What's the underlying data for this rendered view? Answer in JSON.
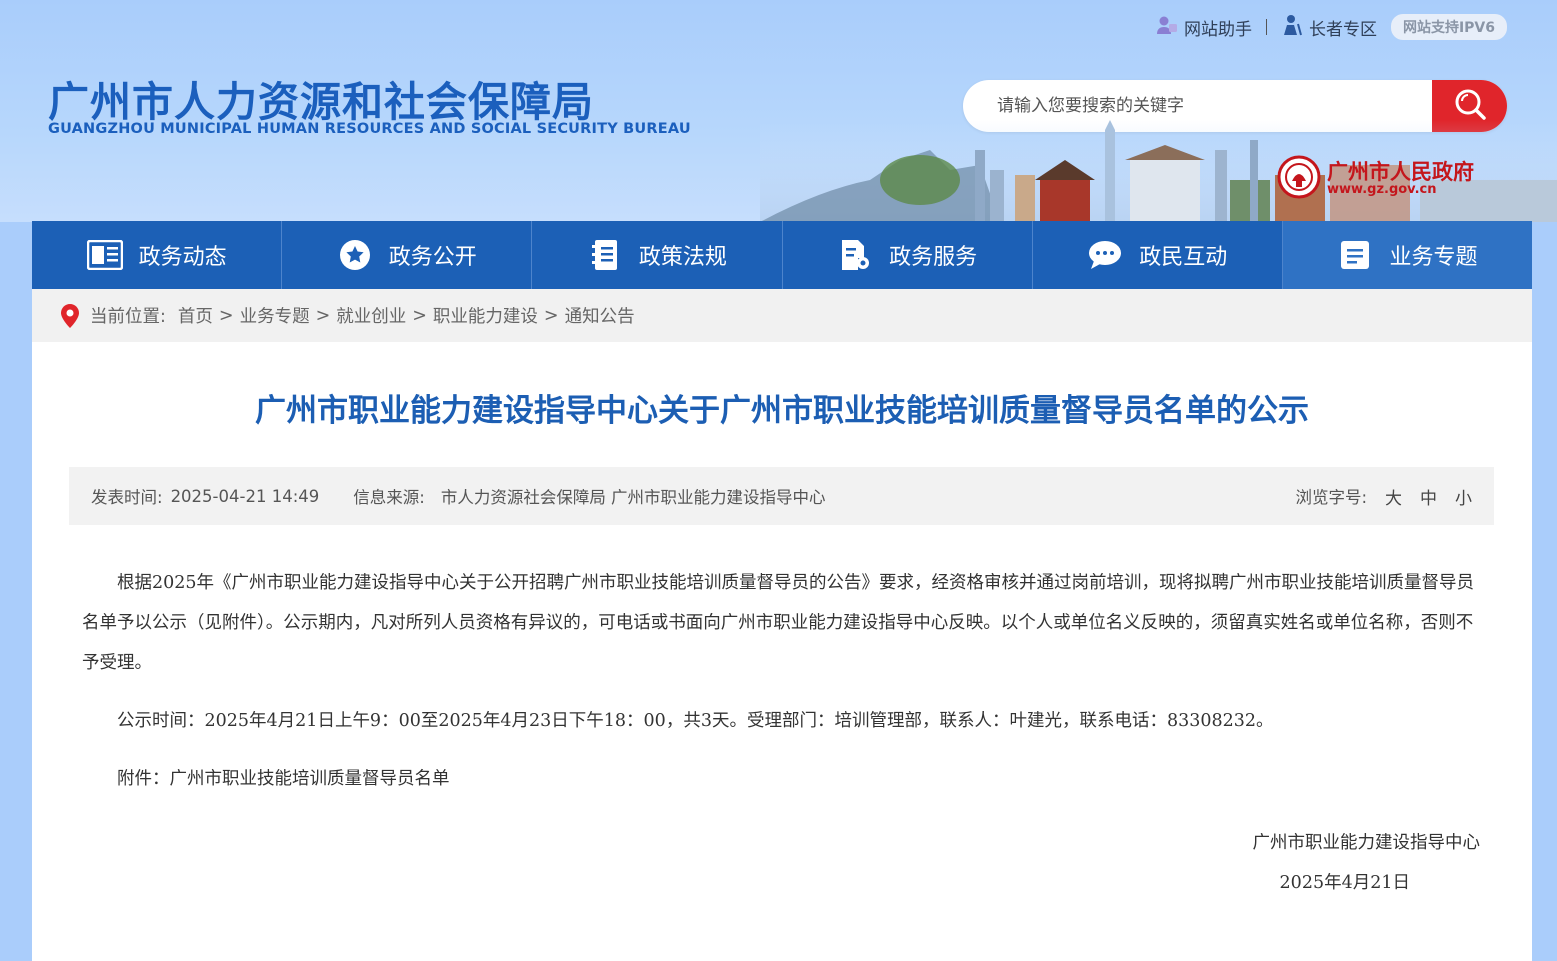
{
  "top_links": {
    "assistant": "网站助手",
    "elderly": "长者专区",
    "ipv6": "网站支持IPV6"
  },
  "site": {
    "name_cn": "广州市人力资源和社会保障局",
    "name_en": "GUANGZHOU MUNICIPAL HUMAN RESOURCES AND SOCIAL SECURITY BUREAU"
  },
  "search": {
    "placeholder": "请输入您要搜索的关键字"
  },
  "gov_badge": {
    "name": "广州市人民政府",
    "url": "www.gz.gov.cn"
  },
  "nav": [
    {
      "label": "政务动态",
      "icon": "news-list-icon"
    },
    {
      "label": "政务公开",
      "icon": "star-circle-icon"
    },
    {
      "label": "政策法规",
      "icon": "notebook-icon"
    },
    {
      "label": "政务服务",
      "icon": "document-gear-icon"
    },
    {
      "label": "政民互动",
      "icon": "chat-bubble-icon"
    },
    {
      "label": "业务专题",
      "icon": "topic-list-icon"
    }
  ],
  "breadcrumb": {
    "label": "当前位置:",
    "items": [
      "首页",
      "业务专题",
      "就业创业",
      "职业能力建设",
      "通知公告"
    ]
  },
  "article": {
    "title": "广州市职业能力建设指导中心关于广州市职业技能培训质量督导员名单的公示",
    "publish_label": "发表时间:",
    "publish_time": "2025-04-21 14:49",
    "source_label": "信息来源:",
    "source": "市人力资源社会保障局 广州市职业能力建设指导中心",
    "font_label": "浏览字号:",
    "font_large": "大",
    "font_medium": "中",
    "font_small": "小",
    "paragraphs": [
      "根据2025年《广州市职业能力建设指导中心关于公开招聘广州市职业技能培训质量督导员的公告》要求，经资格审核并通过岗前培训，现将拟聘广州市职业技能培训质量督导员名单予以公示（见附件）。公示期内，凡对所列人员资格有异议的，可电话或书面向广州市职业能力建设指导中心反映。以个人或单位名义反映的，须留真实姓名或单位名称，否则不予受理。",
      "公示时间：2025年4月21日上午9：00至2025年4月23日下午18：00，共3天。受理部门：培训管理部，联系人：叶建光，联系电话：83308232。",
      "附件：广州市职业技能培训质量督导员名单"
    ],
    "signature": "广州市职业能力建设指导中心",
    "sign_date": "2025年4月21日"
  },
  "colors": {
    "nav_bg": "#1c60b6",
    "title": "#1c5eb3",
    "search_btn": "#e0252b",
    "page_bg": "#aacdfb"
  }
}
